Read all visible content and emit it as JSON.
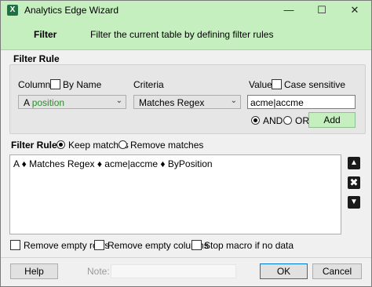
{
  "window": {
    "title": "Analytics Edge Wizard",
    "app_icon_letter": "X",
    "minimize": "—",
    "maximize": "☐",
    "close": "✕"
  },
  "header": {
    "title": "Filter",
    "description": "Filter the current table by defining filter rules"
  },
  "filter_rule": {
    "group_label": "Filter Rule",
    "column_label": "Column",
    "by_name_label": "By Name",
    "by_name_checked": false,
    "criteria_label": "Criteria",
    "value_label": "Value",
    "case_sensitive_label": "Case sensitive",
    "case_sensitive_checked": false,
    "column_prefix": "A",
    "column_value": "position",
    "criteria_value": "Matches Regex",
    "value_input": "acme|accme",
    "and_label": "AND",
    "or_label": "OR",
    "logic_selected": "AND",
    "add_label": "Add"
  },
  "filter_rules": {
    "label": "Filter Rules",
    "keep_label": "Keep matches",
    "remove_label": "Remove matches",
    "mode_selected": "keep",
    "items": [
      "A ♦ Matches Regex ♦ acme|accme ♦ ByPosition"
    ]
  },
  "options": {
    "remove_empty_rows": "Remove empty rows",
    "remove_empty_columns": "Remove empty columns",
    "stop_macro": "Stop macro if no data"
  },
  "footer": {
    "help_label": "Help",
    "note_label": "Note:",
    "note_value": "",
    "ok_label": "OK",
    "cancel_label": "Cancel"
  },
  "colors": {
    "header_bg": "#c6efc0",
    "column_value_color": "#2e8b2e",
    "add_button_bg": "#c6efc0"
  }
}
